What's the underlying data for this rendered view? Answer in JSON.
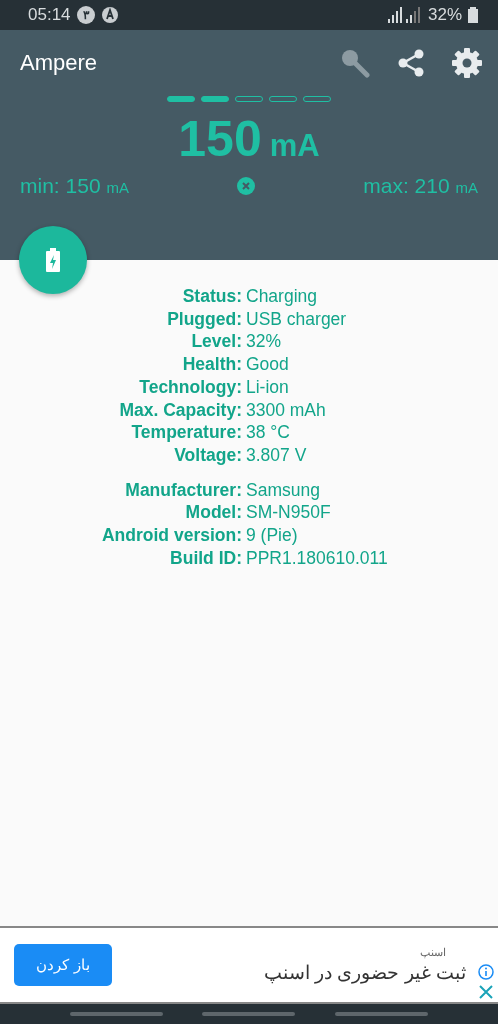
{
  "status_bar": {
    "time": "05:14",
    "notification_badge": "۳",
    "battery": "32%"
  },
  "app_bar": {
    "title": "Ampere"
  },
  "meter": {
    "segments": [
      {
        "filled": true
      },
      {
        "filled": true
      },
      {
        "filled": false
      },
      {
        "filled": false
      },
      {
        "filled": false
      }
    ],
    "current": "150",
    "unit": "mA",
    "min_label": "min:",
    "min_value": "150",
    "min_unit": "mA",
    "max_label": "max:",
    "max_value": "210",
    "max_unit": "mA"
  },
  "battery_info": [
    {
      "label": "Status:",
      "value": "Charging"
    },
    {
      "label": "Plugged:",
      "value": "USB charger"
    },
    {
      "label": "Level:",
      "value": "32%"
    },
    {
      "label": "Health:",
      "value": "Good"
    },
    {
      "label": "Technology:",
      "value": "Li-ion"
    },
    {
      "label": "Max. Capacity:",
      "value": "3300 mAh"
    },
    {
      "label": "Temperature:",
      "value": "38 °C"
    },
    {
      "label": "Voltage:",
      "value": "3.807 V"
    }
  ],
  "device_info": [
    {
      "label": "Manufacturer:",
      "value": "Samsung"
    },
    {
      "label": "Model:",
      "value": "SM-N950F"
    },
    {
      "label": "Android version:",
      "value": "9 (Pie)"
    },
    {
      "label": "Build ID:",
      "value": "PPR1.180610.011"
    }
  ],
  "ad": {
    "button": "باز کردن",
    "advertiser": "اسنپ",
    "headline": "ثبت غیر حضوری در اسنپ"
  }
}
